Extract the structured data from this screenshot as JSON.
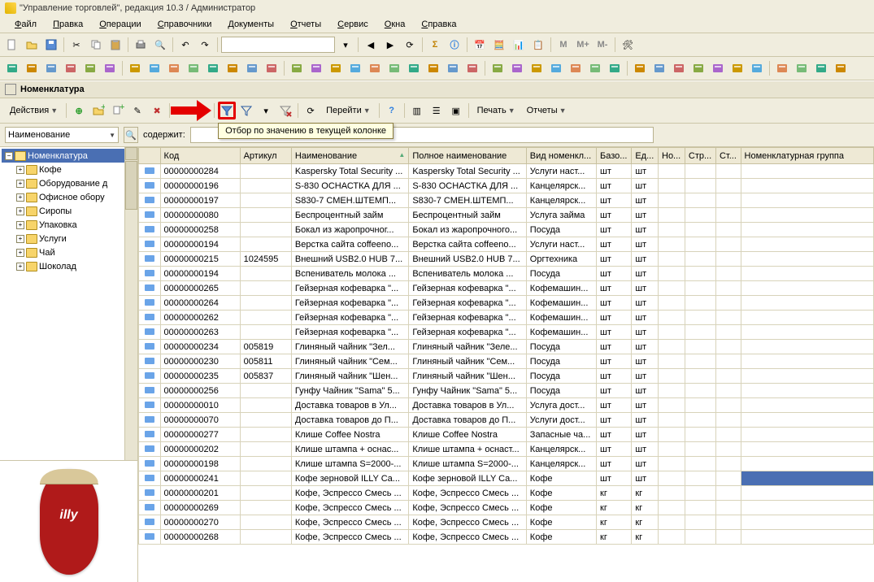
{
  "title": "\"Управление торговлей\", редакция 10.3 / Администратор",
  "menu": [
    "Файл",
    "Правка",
    "Операции",
    "Справочники",
    "Документы",
    "Отчеты",
    "Сервис",
    "Окна",
    "Справка"
  ],
  "listHeader": "Номенклатура",
  "actionsLabel": "Действия",
  "gotoLabel": "Перейти",
  "printLabel": "Печать",
  "reportsLabel": "Отчеты",
  "tooltip": "Отбор по значению в текущей колонке",
  "search": {
    "field": "Наименование",
    "label": "содержит:",
    "value": ""
  },
  "tree": {
    "root": "Номенклатура",
    "items": [
      "Кофе",
      "Оборудование д",
      "Офисное обору",
      "Сиропы",
      "Упаковка",
      "Услуги",
      "Чай",
      "Шоколад"
    ]
  },
  "columns": [
    "",
    "Код",
    "Артикул",
    "Наименование",
    "Полное наименование",
    "Вид номенкл...",
    "Базо...",
    "Ед...",
    "Но...",
    "Стр...",
    "Ст...",
    "Номенклатурная группа"
  ],
  "rows": [
    {
      "code": "00000000284",
      "art": "",
      "name": "Kaspersky Total Security ...",
      "full": "Kaspersky Total Security ...",
      "type": "Услуги наст...",
      "b": "шт",
      "e": "шт"
    },
    {
      "code": "00000000196",
      "art": "",
      "name": "S-830 ОСНАСТКА ДЛЯ ...",
      "full": "S-830 ОСНАСТКА ДЛЯ ...",
      "type": "Канцелярск...",
      "b": "шт",
      "e": "шт"
    },
    {
      "code": "00000000197",
      "art": "",
      "name": "S830-7 СМЕН.ШТЕМП...",
      "full": "S830-7 СМЕН.ШТЕМП...",
      "type": "Канцелярск...",
      "b": "шт",
      "e": "шт"
    },
    {
      "code": "00000000080",
      "art": "",
      "name": "Беспроцентный займ",
      "full": "Беспроцентный займ",
      "type": "Услуга займа",
      "b": "шт",
      "e": "шт"
    },
    {
      "code": "00000000258",
      "art": "",
      "name": "Бокал из жаропрочног...",
      "full": "Бокал из жаропрочного...",
      "type": "Посуда",
      "b": "шт",
      "e": "шт"
    },
    {
      "code": "00000000194",
      "art": "",
      "name": "Верстка сайта coffeeno...",
      "full": "Верстка сайта coffeeno...",
      "type": "Услуги наст...",
      "b": "шт",
      "e": "шт"
    },
    {
      "code": "00000000215",
      "art": "1024595",
      "name": "Внешний USB2.0 HUB 7...",
      "full": "Внешний USB2.0 HUB 7...",
      "type": "Оргтехника",
      "b": "шт",
      "e": "шт"
    },
    {
      "code": "00000000194",
      "art": "",
      "name": "Вспениватель молока ...",
      "full": "Вспениватель молока ...",
      "type": "Посуда",
      "b": "шт",
      "e": "шт"
    },
    {
      "code": "00000000265",
      "art": "",
      "name": "Гейзерная кофеварка \"...",
      "full": "Гейзерная кофеварка \"...",
      "type": "Кофемашин...",
      "b": "шт",
      "e": "шт"
    },
    {
      "code": "00000000264",
      "art": "",
      "name": "Гейзерная кофеварка \"...",
      "full": "Гейзерная кофеварка \"...",
      "type": "Кофемашин...",
      "b": "шт",
      "e": "шт"
    },
    {
      "code": "00000000262",
      "art": "",
      "name": "Гейзерная кофеварка \"...",
      "full": "Гейзерная кофеварка \"...",
      "type": "Кофемашин...",
      "b": "шт",
      "e": "шт"
    },
    {
      "code": "00000000263",
      "art": "",
      "name": "Гейзерная кофеварка \"...",
      "full": "Гейзерная кофеварка \"...",
      "type": "Кофемашин...",
      "b": "шт",
      "e": "шт"
    },
    {
      "code": "00000000234",
      "art": "005819",
      "name": "Глиняный чайник \"Зел...",
      "full": "Глиняный чайник \"Зеле...",
      "type": "Посуда",
      "b": "шт",
      "e": "шт"
    },
    {
      "code": "00000000230",
      "art": "005811",
      "name": "Глиняный чайник \"Сем...",
      "full": "Глиняный чайник \"Сем...",
      "type": "Посуда",
      "b": "шт",
      "e": "шт"
    },
    {
      "code": "00000000235",
      "art": "005837",
      "name": "Глиняный чайник \"Шен...",
      "full": "Глиняный чайник \"Шен...",
      "type": "Посуда",
      "b": "шт",
      "e": "шт"
    },
    {
      "code": "00000000256",
      "art": "",
      "name": "Гунфу Чайник \"Sama\" 5...",
      "full": "Гунфу Чайник \"Sama\" 5...",
      "type": "Посуда",
      "b": "шт",
      "e": "шт"
    },
    {
      "code": "00000000010",
      "art": "",
      "name": "Доставка товаров в Ул...",
      "full": "Доставка товаров в Ул...",
      "type": "Услуга дост...",
      "b": "шт",
      "e": "шт"
    },
    {
      "code": "00000000070",
      "art": "",
      "name": "Доставка товаров до П...",
      "full": "Доставка товаров до П...",
      "type": "Услуги дост...",
      "b": "шт",
      "e": "шт"
    },
    {
      "code": "00000000277",
      "art": "",
      "name": "Клише Coffee Nostra",
      "full": "Клише Coffee Nostra",
      "type": "Запасные ча...",
      "b": "шт",
      "e": "шт"
    },
    {
      "code": "00000000202",
      "art": "",
      "name": "Клише штампа + оснас...",
      "full": "Клише штампа + оснаст...",
      "type": "Канцелярск...",
      "b": "шт",
      "e": "шт"
    },
    {
      "code": "00000000198",
      "art": "",
      "name": "Клише штампа S=2000-...",
      "full": "Клише штампа S=2000-...",
      "type": "Канцелярск...",
      "b": "шт",
      "e": "шт"
    },
    {
      "code": "00000000241",
      "art": "",
      "name": "Кофе зерновой ILLY Ca...",
      "full": "Кофе зерновой ILLY Ca...",
      "type": "Кофе",
      "b": "шт",
      "e": "шт",
      "sel": true
    },
    {
      "code": "00000000201",
      "art": "",
      "name": "Кофе, Эспрессо Смесь ...",
      "full": "Кофе, Эспрессо Смесь ...",
      "type": "Кофе",
      "b": "кг",
      "e": "кг"
    },
    {
      "code": "00000000269",
      "art": "",
      "name": "Кофе, Эспрессо Смесь ...",
      "full": "Кофе, Эспрессо Смесь ...",
      "type": "Кофе",
      "b": "кг",
      "e": "кг"
    },
    {
      "code": "00000000270",
      "art": "",
      "name": "Кофе, Эспрессо Смесь ...",
      "full": "Кофе, Эспрессо Смесь ...",
      "type": "Кофе",
      "b": "кг",
      "e": "кг"
    },
    {
      "code": "00000000268",
      "art": "",
      "name": "Кофе, Эспрессо Смесь ...",
      "full": "Кофе, Эспрессо Смесь ...",
      "type": "Кофе",
      "b": "кг",
      "e": "кг"
    }
  ]
}
